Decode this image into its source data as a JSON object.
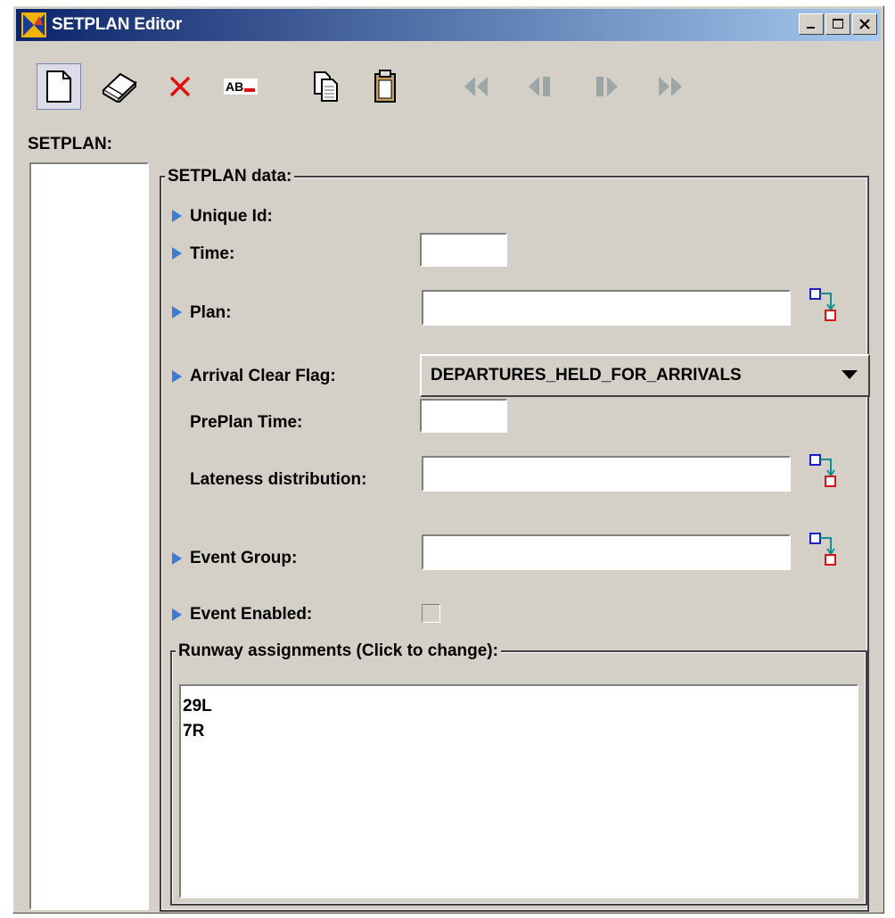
{
  "window": {
    "title": "SETPLAN Editor"
  },
  "toolbar": {
    "buttons": [
      "new-icon",
      "eraser-icon",
      "delete-icon",
      "rename-icon",
      "copy-icon",
      "paste-icon",
      "first-icon",
      "previous-icon",
      "next-icon",
      "last-icon"
    ]
  },
  "sidebar": {
    "label": "SETPLAN:"
  },
  "form": {
    "group_title": "SETPLAN data:",
    "fields": {
      "unique_id": {
        "label": "Unique Id:"
      },
      "time": {
        "label": "Time:",
        "value": ""
      },
      "plan": {
        "label": "Plan:",
        "value": ""
      },
      "arrival_clear_flag": {
        "label": "Arrival Clear Flag:",
        "value": "DEPARTURES_HELD_FOR_ARRIVALS"
      },
      "preplan_time": {
        "label": "PrePlan Time:",
        "value": ""
      },
      "lateness_distribution": {
        "label": "Lateness distribution:",
        "value": ""
      },
      "event_group": {
        "label": "Event Group:",
        "value": ""
      },
      "event_enabled": {
        "label": "Event Enabled:",
        "checked": false
      }
    },
    "runway": {
      "title": "Runway assignments (Click to change):",
      "items": [
        "29L",
        "7R"
      ]
    }
  },
  "colors": {
    "title_start": "#0a246a",
    "title_end": "#a6caf0",
    "arrow": "#3c7bd6",
    "window_bg": "#d4d0c8"
  }
}
